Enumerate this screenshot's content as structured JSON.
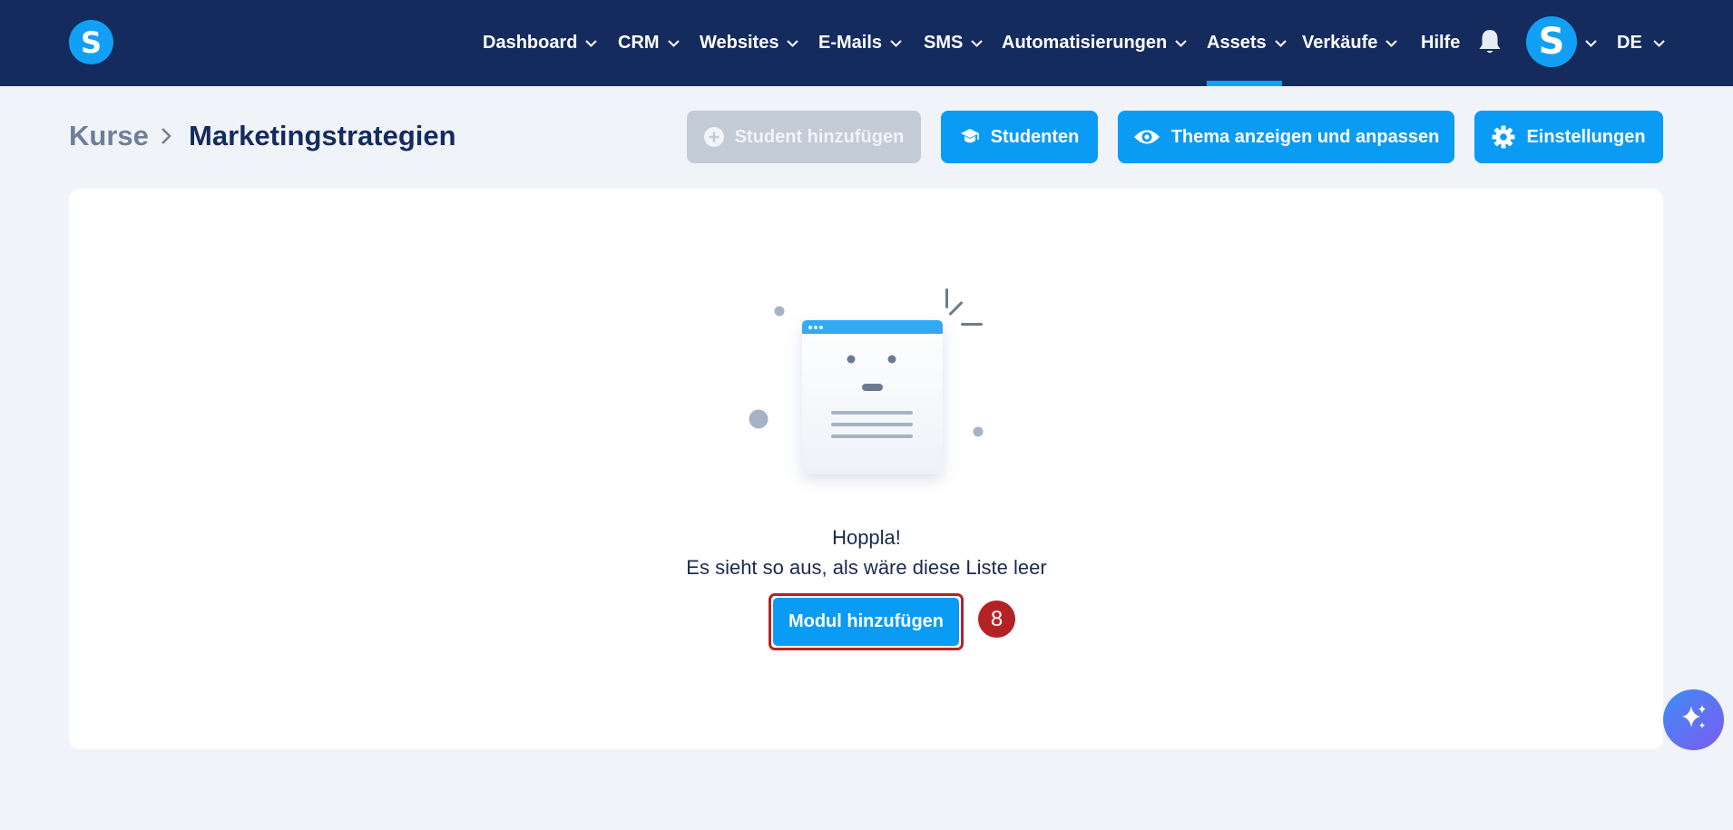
{
  "app": {
    "logo_letter": "S",
    "accent_color": "#12a0f7",
    "nav_background": "#152b5e"
  },
  "nav": {
    "items": [
      {
        "label": "Dashboard",
        "has_dropdown": true
      },
      {
        "label": "CRM",
        "has_dropdown": true
      },
      {
        "label": "Websites",
        "has_dropdown": true
      },
      {
        "label": "E-Mails",
        "has_dropdown": true
      },
      {
        "label": "SMS",
        "has_dropdown": true
      },
      {
        "label": "Automatisierungen",
        "has_dropdown": true
      },
      {
        "label": "Assets",
        "has_dropdown": true,
        "active": true
      },
      {
        "label": "Verkäufe",
        "has_dropdown": true
      },
      {
        "label": "Hilfe",
        "has_dropdown": false
      }
    ],
    "notifications_icon": "bell-icon",
    "avatar_letter": "S",
    "language": "DE"
  },
  "breadcrumb": {
    "root": "Kurse",
    "separator_icon": "chevron-right-icon",
    "current": "Marketingstrategien"
  },
  "actions": {
    "add_student": {
      "label": "Student hinzufügen",
      "icon": "plus-circle-icon",
      "disabled": true
    },
    "students": {
      "label": "Studenten",
      "icon": "graduation-cap-icon"
    },
    "theme": {
      "label": "Thema anzeigen und anpassen",
      "icon": "eye-icon"
    },
    "settings": {
      "label": "Einstellungen",
      "icon": "gear-icon"
    }
  },
  "empty_state": {
    "illustration_icon": "empty-list-illustration",
    "title": "Hoppla!",
    "message": "Es sieht so aus, als wäre diese Liste leer",
    "button_label": "Modul hinzufügen"
  },
  "annotation": {
    "step_number": "8",
    "color": "#b52226"
  },
  "assistant": {
    "icon": "sparkle-icon"
  }
}
